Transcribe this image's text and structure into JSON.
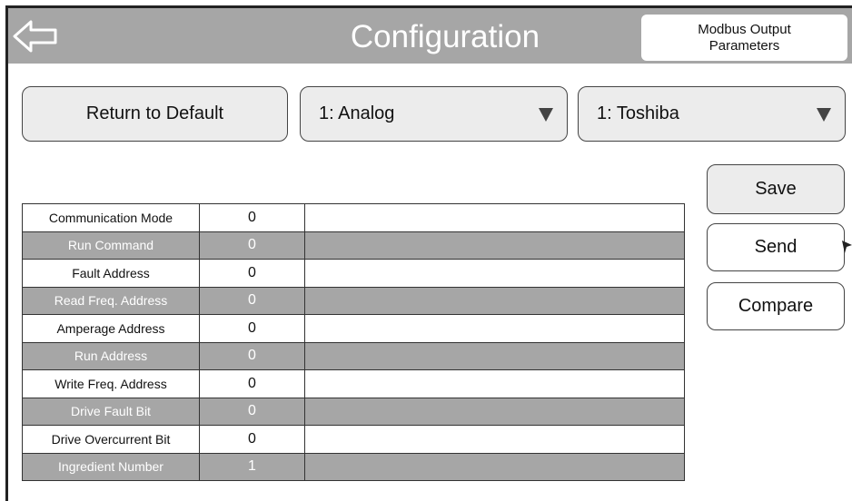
{
  "header": {
    "title": "Configuration",
    "label": "Modbus Output Parameters"
  },
  "controls": {
    "return_default_label": "Return to Default",
    "type_dropdown": "1: Analog",
    "drive_dropdown": "1: Toshiba",
    "save_label": "Save",
    "send_label": "Send",
    "compare_label": "Compare"
  },
  "table": {
    "rows": [
      {
        "label": "Communication Mode",
        "value": "0"
      },
      {
        "label": "Run Command",
        "value": "0"
      },
      {
        "label": "Fault Address",
        "value": "0"
      },
      {
        "label": "Read Freq. Address",
        "value": "0"
      },
      {
        "label": "Amperage Address",
        "value": "0"
      },
      {
        "label": "Run Address",
        "value": "0"
      },
      {
        "label": "Write Freq. Address",
        "value": "0"
      },
      {
        "label": "Drive Fault Bit",
        "value": "0"
      },
      {
        "label": "Drive Overcurrent Bit",
        "value": "0"
      },
      {
        "label": "Ingredient Number",
        "value": "1"
      }
    ]
  },
  "icons": {
    "back": "back-arrow-icon",
    "dropdown": "triangle-down-icon"
  },
  "colors": {
    "header_bg": "#a6a6a6",
    "button_bg": "#ececec",
    "alt_row_bg": "#a6a6a6"
  }
}
